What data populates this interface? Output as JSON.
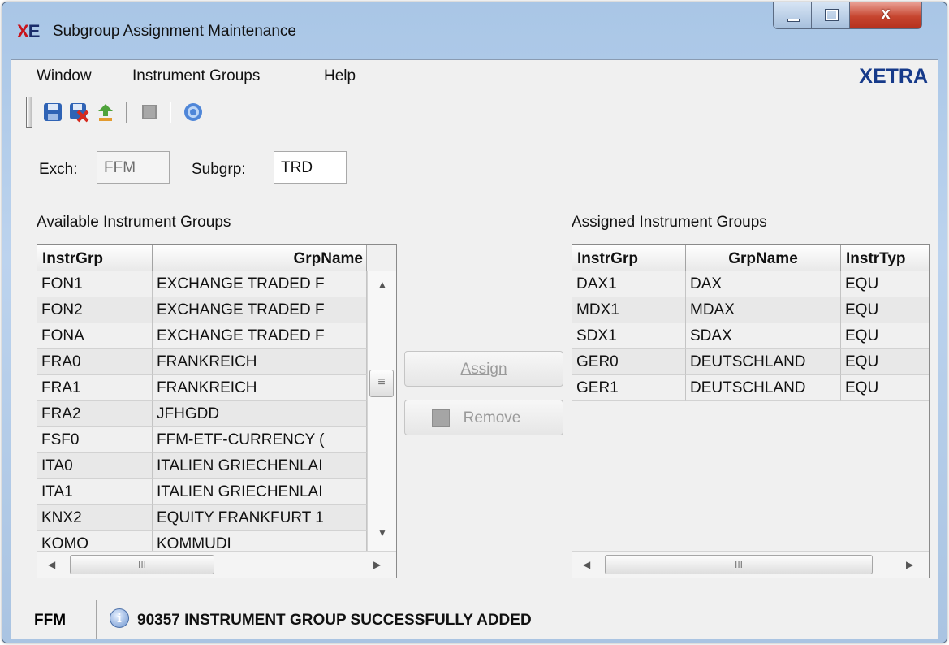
{
  "window": {
    "app_icon_text_1": "X",
    "app_icon_text_2": "E",
    "title": "Subgroup Assignment Maintenance",
    "minimize_icon": "minimize-icon",
    "maximize_icon": "maximize-icon",
    "close_icon": "close-icon",
    "close_glyph": "x"
  },
  "menu": {
    "items": [
      "Window",
      "Instrument Groups",
      "Help"
    ],
    "brand": "XETRA"
  },
  "toolbar": {
    "icons": [
      "save-icon",
      "save-delete-icon",
      "recycle-icon",
      "stop-icon",
      "help-icon"
    ]
  },
  "form": {
    "exch_label": "Exch:",
    "exch_value": "FFM",
    "subgrp_label": "Subgrp:",
    "subgrp_value": "TRD"
  },
  "available": {
    "title": "Available Instrument Groups",
    "columns": [
      "InstrGrp",
      "GrpName"
    ],
    "rows": [
      [
        "FON1",
        "EXCHANGE TRADED F"
      ],
      [
        "FON2",
        "EXCHANGE TRADED F"
      ],
      [
        "FONA",
        "EXCHANGE TRADED F"
      ],
      [
        "FRA0",
        "FRANKREICH"
      ],
      [
        "FRA1",
        "FRANKREICH"
      ],
      [
        "FRA2",
        "JFHGDD"
      ],
      [
        "FSF0",
        "FFM-ETF-CURRENCY ("
      ],
      [
        "ITA0",
        "ITALIEN GRIECHENLAI"
      ],
      [
        "ITA1",
        "ITALIEN GRIECHENLAI"
      ],
      [
        "KNX2",
        "EQUITY FRANKFURT 1"
      ],
      [
        "KOMO",
        "KOMMUDI"
      ]
    ]
  },
  "buttons": {
    "assign": "Assign",
    "remove": "Remove"
  },
  "assigned": {
    "title": "Assigned Instrument Groups",
    "columns": [
      "InstrGrp",
      "GrpName",
      "InstrTyp"
    ],
    "rows": [
      [
        "DAX1",
        "DAX",
        "EQU"
      ],
      [
        "MDX1",
        "MDAX",
        "EQU"
      ],
      [
        "SDX1",
        "SDAX",
        "EQU"
      ],
      [
        "GER0",
        "DEUTSCHLAND",
        "EQU"
      ],
      [
        "GER1",
        "DEUTSCHLAND",
        "EQU"
      ]
    ]
  },
  "status": {
    "exchange": "FFM",
    "icon": "info-icon",
    "message": "90357 INSTRUMENT GROUP SUCCESSFULLY ADDED"
  },
  "scroll_glyphs": {
    "up": "▲",
    "down": "▼",
    "left": "◀",
    "right": "▶",
    "thumb_grip": "III",
    "vthumb_grip": "≡"
  },
  "colors": {
    "brand": "#163a8a",
    "close_button": "#c6452f",
    "window_frame": "#bcd3ee"
  }
}
